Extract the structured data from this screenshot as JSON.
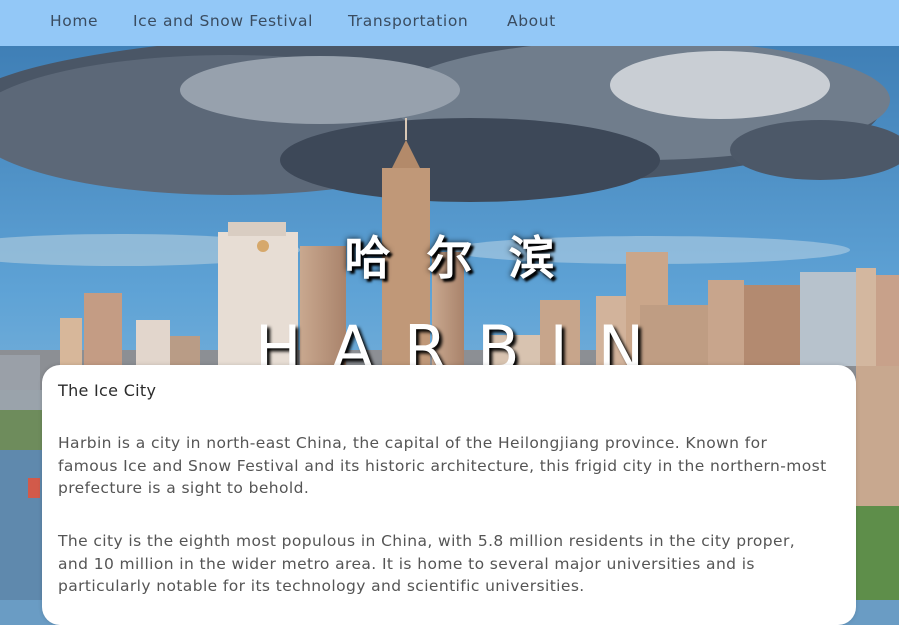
{
  "nav": {
    "items": [
      "Home",
      "Ice and Snow Festival",
      "Transportation",
      "About"
    ]
  },
  "hero": {
    "title_cn": "哈尔滨",
    "title_en": "HARBIN"
  },
  "card": {
    "title": "The Ice City",
    "paragraphs": [
      "Harbin is a city in north-east China, the capital of the Heilongjiang province. Known for famous Ice and Snow Festival and its historic architecture, this frigid city in the northern-most prefecture is a sight to behold.",
      "The city is the eighth most populous in China, with 5.8 million residents in the city proper, and 10 million in the wider metro area. It is home to several major universities and is particularly notable for its technology and scientific universities."
    ]
  },
  "colors": {
    "nav_bg": "#93c8f7",
    "nav_text": "#3a4c60",
    "sky": "#5f9fd0",
    "card_bg": "#ffffff"
  }
}
